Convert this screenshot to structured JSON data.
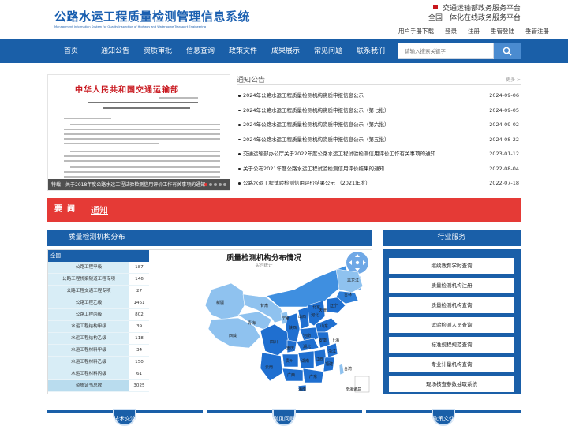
{
  "header": {
    "title": "公路水运工程质量检测管理信息系统",
    "subtitle": "Management Information System for Quality Inspection of Highway and Waterborne Transport Engineering",
    "platform_1": "交通运输部政务服务平台",
    "platform_2": "全国一体化在线政务服务平台",
    "links": [
      "用户手册下载",
      "登录",
      "注册",
      "垂管登陆",
      "垂管注册"
    ]
  },
  "nav": {
    "items": [
      "首页",
      "通知公告",
      "资质审批",
      "信息查询",
      "政策文件",
      "成果展示",
      "常见问题",
      "联系我们"
    ],
    "search_placeholder": "请输入搜索关键字"
  },
  "banner": {
    "doc_heading": "中华人民共和国交通运输部",
    "caption": "特载：关于2018年度公路水运工程试验检测信用评价工作有关事项的通知"
  },
  "notices": {
    "title": "通知公告",
    "more": "更多 >",
    "items": [
      {
        "text": "2024年公路水运工程质量检测机构资质申报信息公示",
        "date": "2024-09-06"
      },
      {
        "text": "2024年公路水运工程质量检测机构资质申报信息公示（第七批）",
        "date": "2024-09-05"
      },
      {
        "text": "2024年公路水运工程质量检测机构资质申报信息公示（第六批）",
        "date": "2024-09-02"
      },
      {
        "text": "2024年公路水运工程质量检测机构资质申报信息公示（第五批）",
        "date": "2024-08-22"
      },
      {
        "text": "交通运输部办公厅关于2022年度公路水运工程试验检测信用评价工作有关事项的通知",
        "date": "2023-01-12"
      },
      {
        "text": "关于公布2021年度公路水运工程试验检测信用评价结果的通知",
        "date": "2022-08-04"
      },
      {
        "text": "公路水运工程试验检测信用评价结果公示 （2021年度）",
        "date": "2022-07-18"
      }
    ]
  },
  "news_bar": {
    "label": "要闻",
    "link": "通知"
  },
  "org": {
    "title": "质量检测机构分布",
    "region": "全国",
    "rows": [
      {
        "name": "公路工程甲级",
        "count": "187"
      },
      {
        "name": "公路工程桥梁隧道工程专项",
        "count": "146"
      },
      {
        "name": "公路工程交通工程专项",
        "count": "27"
      },
      {
        "name": "公路工程乙级",
        "count": "1461"
      },
      {
        "name": "公路工程丙级",
        "count": "802"
      },
      {
        "name": "水运工程结构甲级",
        "count": "39"
      },
      {
        "name": "水运工程结构乙级",
        "count": "118"
      },
      {
        "name": "水运工程材料甲级",
        "count": "34"
      },
      {
        "name": "水运工程材料乙级",
        "count": "150"
      },
      {
        "name": "水运工程材料丙级",
        "count": "61"
      }
    ],
    "total": {
      "name": "资质证书总数",
      "count": "3025"
    },
    "map_title": "质量检测机构分布情况",
    "map_subtitle": "实时统计",
    "provinces": [
      "黑龙江",
      "吉林",
      "辽宁",
      "新疆",
      "西藏",
      "青海",
      "甘肃",
      "宁夏",
      "陕西",
      "山西",
      "河北",
      "北京",
      "天津",
      "山东",
      "河南",
      "湖北",
      "四川",
      "重庆",
      "安徽",
      "浙江",
      "福建",
      "贵州",
      "云南",
      "湖南",
      "江西",
      "广西",
      "广东",
      "海南",
      "台湾",
      "南海诸岛",
      "上海"
    ]
  },
  "services": {
    "title": "行业服务",
    "items": [
      "继续教育学时查询",
      "质量检测机构注册",
      "质量检测机构查询",
      "试验检测人员查询",
      "标准规程规范查询",
      "专业计量机构查询",
      "现场核查参数抽取系统"
    ]
  },
  "tiles": [
    "技术交流",
    "常见问题",
    "政策文件"
  ],
  "colors": {
    "brand_blue": "#1a5fa8",
    "accent_red": "#e53a36",
    "map_dark": "#1f6fd0",
    "map_light": "#8fc2ef"
  }
}
